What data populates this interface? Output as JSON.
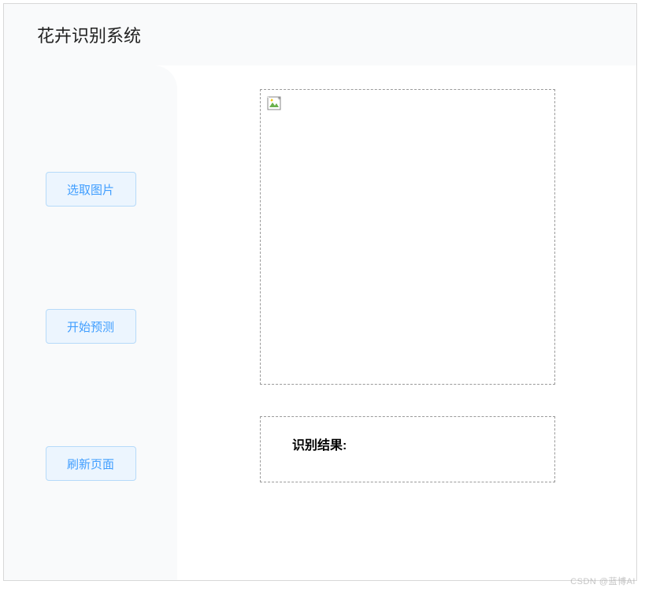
{
  "header": {
    "title": "花卉识别系统"
  },
  "sidebar": {
    "buttons": [
      {
        "label": "选取图片"
      },
      {
        "label": "开始预测"
      },
      {
        "label": "刷新页面"
      }
    ]
  },
  "main": {
    "result_label": "识别结果:"
  },
  "watermark": "CSDN @蓝博AI"
}
